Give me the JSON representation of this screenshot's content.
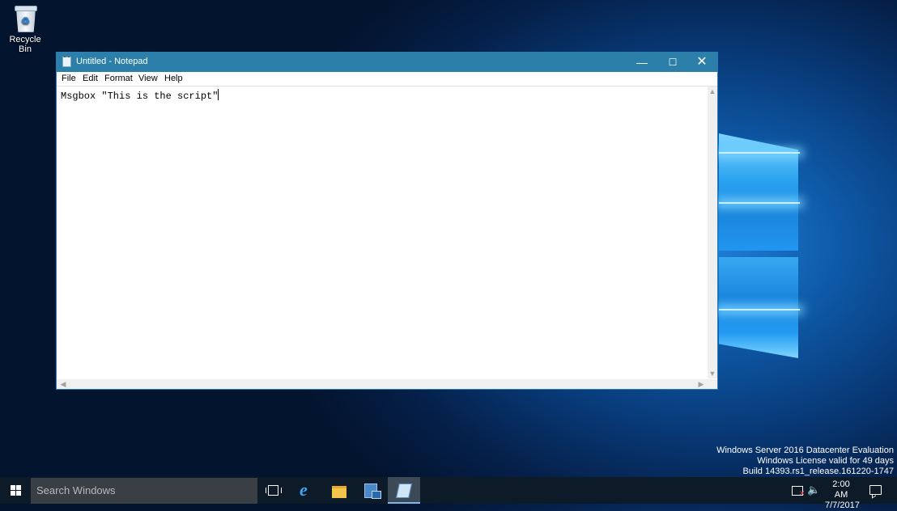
{
  "desktop": {
    "recycle_bin_label": "Recycle Bin",
    "watermark": [
      "Windows Server 2016 Datacenter Evaluation",
      "Windows License valid for 49 days",
      "Build 14393.rs1_release.161220-1747"
    ]
  },
  "notepad": {
    "title": "Untitled - Notepad",
    "controls": {
      "minimize": "—",
      "maximize": "☐",
      "close": "✕"
    },
    "menu": [
      "File",
      "Edit",
      "Format",
      "View",
      "Help"
    ],
    "content": "Msgbox \"This is the script\""
  },
  "taskbar": {
    "search_placeholder": "Search Windows",
    "pinned": [
      "task-view-icon",
      "internet-explorer-icon",
      "file-explorer-icon",
      "server-manager-icon",
      "notepad-icon"
    ],
    "clock_time": "2:00 AM",
    "clock_date": "7/7/2017"
  },
  "colors": {
    "titlebar": "#2b7fa8",
    "taskbar": "#0d1a28",
    "search_box": "#3a3f45"
  }
}
